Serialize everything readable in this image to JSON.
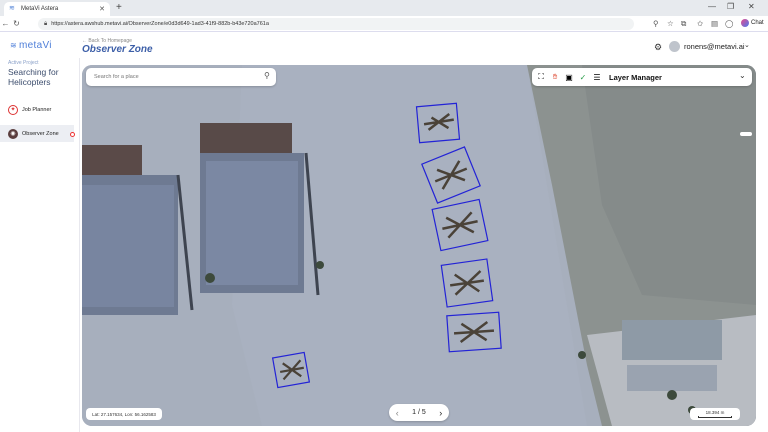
{
  "browser": {
    "tab_title": "MetaVi Astera",
    "url": "https://astera.awshub.metavi.ai/ObserverZone/e0d3d649-1ad3-41f9-882b-b43e720a761a",
    "chat_label": "Chat"
  },
  "app": {
    "logo_text": "metaVi",
    "back_link": "← Back To Homepage",
    "page_title": "Observer Zone",
    "user_email": "ronens@metavi.ai"
  },
  "sidebar": {
    "project_label": "Active Project",
    "project_name": "Searching for Helicopters",
    "items": [
      {
        "label": "Job Planner"
      },
      {
        "label": "Observer Zone"
      }
    ]
  },
  "map": {
    "search_placeholder": "Search for a place",
    "layer_manager_label": "Layer Manager",
    "coordinates": "Lat: 27.157634, Lon: 56.162583",
    "pager": "1 / 5",
    "scale": "18.394 m",
    "detection_color": "#2323d6",
    "detections": 6
  }
}
